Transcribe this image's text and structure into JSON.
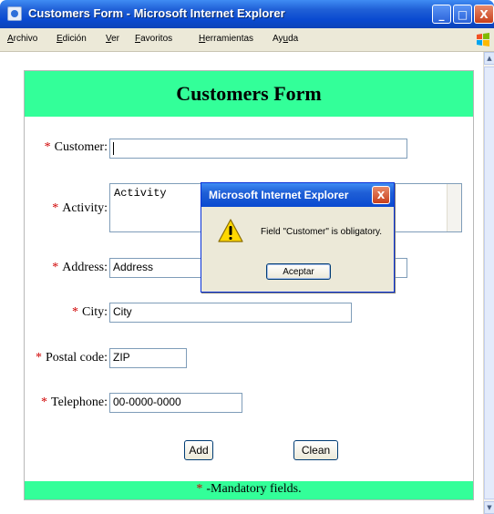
{
  "window": {
    "title": "Customers Form - Microsoft Internet Explorer",
    "min_glyph": "_",
    "max_glyph": "□",
    "close_glyph": "X"
  },
  "menu": {
    "items": [
      {
        "prefix": "",
        "hot": "A",
        "rest": "rchivo"
      },
      {
        "prefix": "",
        "hot": "E",
        "rest": "dición"
      },
      {
        "prefix": "",
        "hot": "V",
        "rest": "er"
      },
      {
        "prefix": "",
        "hot": "F",
        "rest": "avoritos"
      },
      {
        "prefix": "",
        "hot": "H",
        "rest": "erramientas"
      },
      {
        "prefix": "Ay",
        "hot": "u",
        "rest": "da"
      }
    ]
  },
  "form": {
    "title": "Customers Form",
    "required_marker": "*",
    "fields": {
      "customer": {
        "label": "Customer:",
        "value": ""
      },
      "activity": {
        "label": "Activity:",
        "value": "Activity"
      },
      "address": {
        "label": "Address:",
        "value": "Address"
      },
      "city": {
        "label": "City:",
        "value": "City"
      },
      "postal": {
        "label": "Postal code:",
        "value": "ZIP"
      },
      "telephone": {
        "label": "Telephone:",
        "value": "00-0000-0000"
      }
    },
    "add_label": "Add",
    "clean_label": "Clean",
    "footer_text": "-Mandatory fields."
  },
  "dialog": {
    "title": "Microsoft Internet Explorer",
    "close_glyph": "X",
    "message": "Field \"Customer\" is obligatory.",
    "ok_label": "Aceptar"
  },
  "colors": {
    "band": "#33ff99",
    "required": "#d00000",
    "titlebar": "#0a4ad0"
  },
  "icons": [
    "ie-icon",
    "windows-flag-icon",
    "warning-icon"
  ]
}
